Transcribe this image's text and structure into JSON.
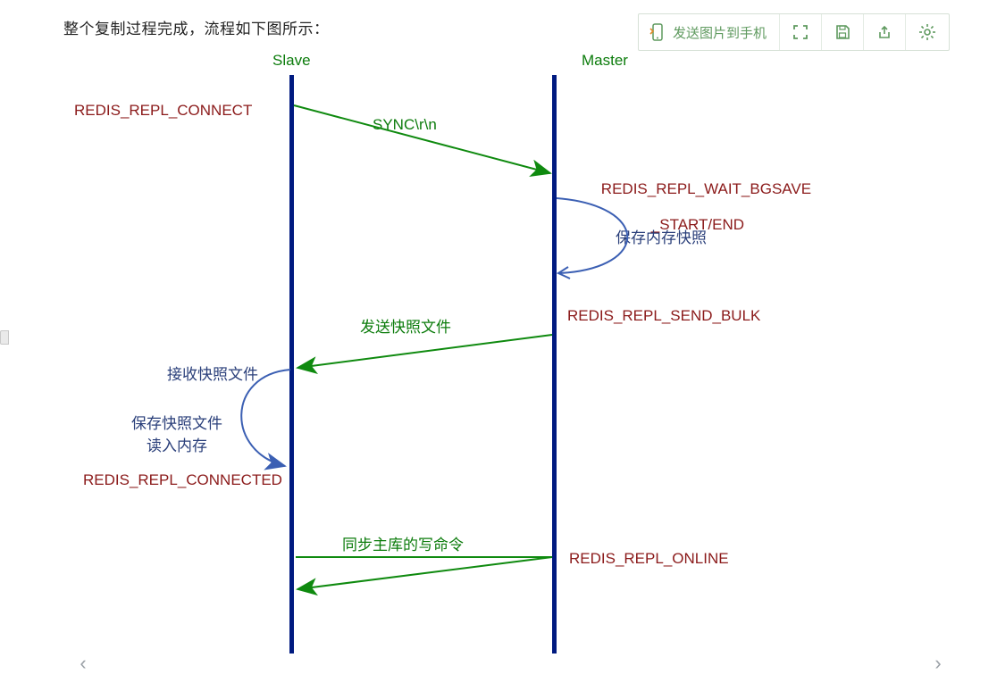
{
  "caption": "整个复制过程完成，流程如下图所示：",
  "toolbar": {
    "send_label": "发送图片到手机",
    "icons": {
      "phone": "phone-icon",
      "expand": "expand-icon",
      "save": "save-icon",
      "share": "share-icon",
      "settings": "gear-icon"
    }
  },
  "diagram": {
    "lifelines": {
      "slave": "Slave",
      "master": "Master"
    },
    "states": {
      "connect": "REDIS_REPL_CONNECT",
      "wait_bgsave_line1": "REDIS_REPL_WAIT_BGSAVE",
      "wait_bgsave_line2": "_START/END",
      "send_bulk": "REDIS_REPL_SEND_BULK",
      "connected": "REDIS_REPL_CONNECTED",
      "online": "REDIS_REPL_ONLINE"
    },
    "messages": {
      "sync": "SYNC\\r\\n",
      "send_snapshot": "发送快照文件",
      "sync_write_cmds": "同步主库的写命令"
    },
    "notes": {
      "save_mem_snapshot": "保存内存快照",
      "recv_snapshot": "接收快照文件",
      "save_snapshot_line1": "保存快照文件",
      "save_snapshot_line2": "读入内存"
    }
  },
  "colors": {
    "lifeline": "#001a80",
    "state": "#8b1a1a",
    "header": "#0c7c0c",
    "arrow_green": "#0f8a0f",
    "curve_blue": "#3b5fb3",
    "toolbar_text": "#5f9a5f"
  }
}
